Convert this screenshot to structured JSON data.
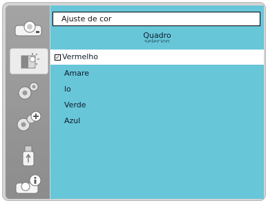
{
  "sidebar": {
    "items": [
      {
        "icon": "projector-icon"
      },
      {
        "icon": "color-adjust-icon",
        "active": true
      },
      {
        "icon": "gear-icon"
      },
      {
        "icon": "gear-plus-icon"
      },
      {
        "icon": "usb-icon"
      },
      {
        "icon": "projector-info-icon"
      }
    ]
  },
  "menu": {
    "title": "Ajuste de cor",
    "subtitle": "Quadro",
    "subtitle_2": "selecion",
    "items": [
      {
        "label": "Vermelho",
        "checked": true
      },
      {
        "label": "Amare"
      },
      {
        "label": "lo"
      },
      {
        "label": "Verde"
      },
      {
        "label": "Azul"
      }
    ],
    "check_mark": "✓"
  },
  "colors": {
    "panel": "#68c6d9",
    "selected_row": "#ffffff",
    "sidebar": "#999999"
  }
}
